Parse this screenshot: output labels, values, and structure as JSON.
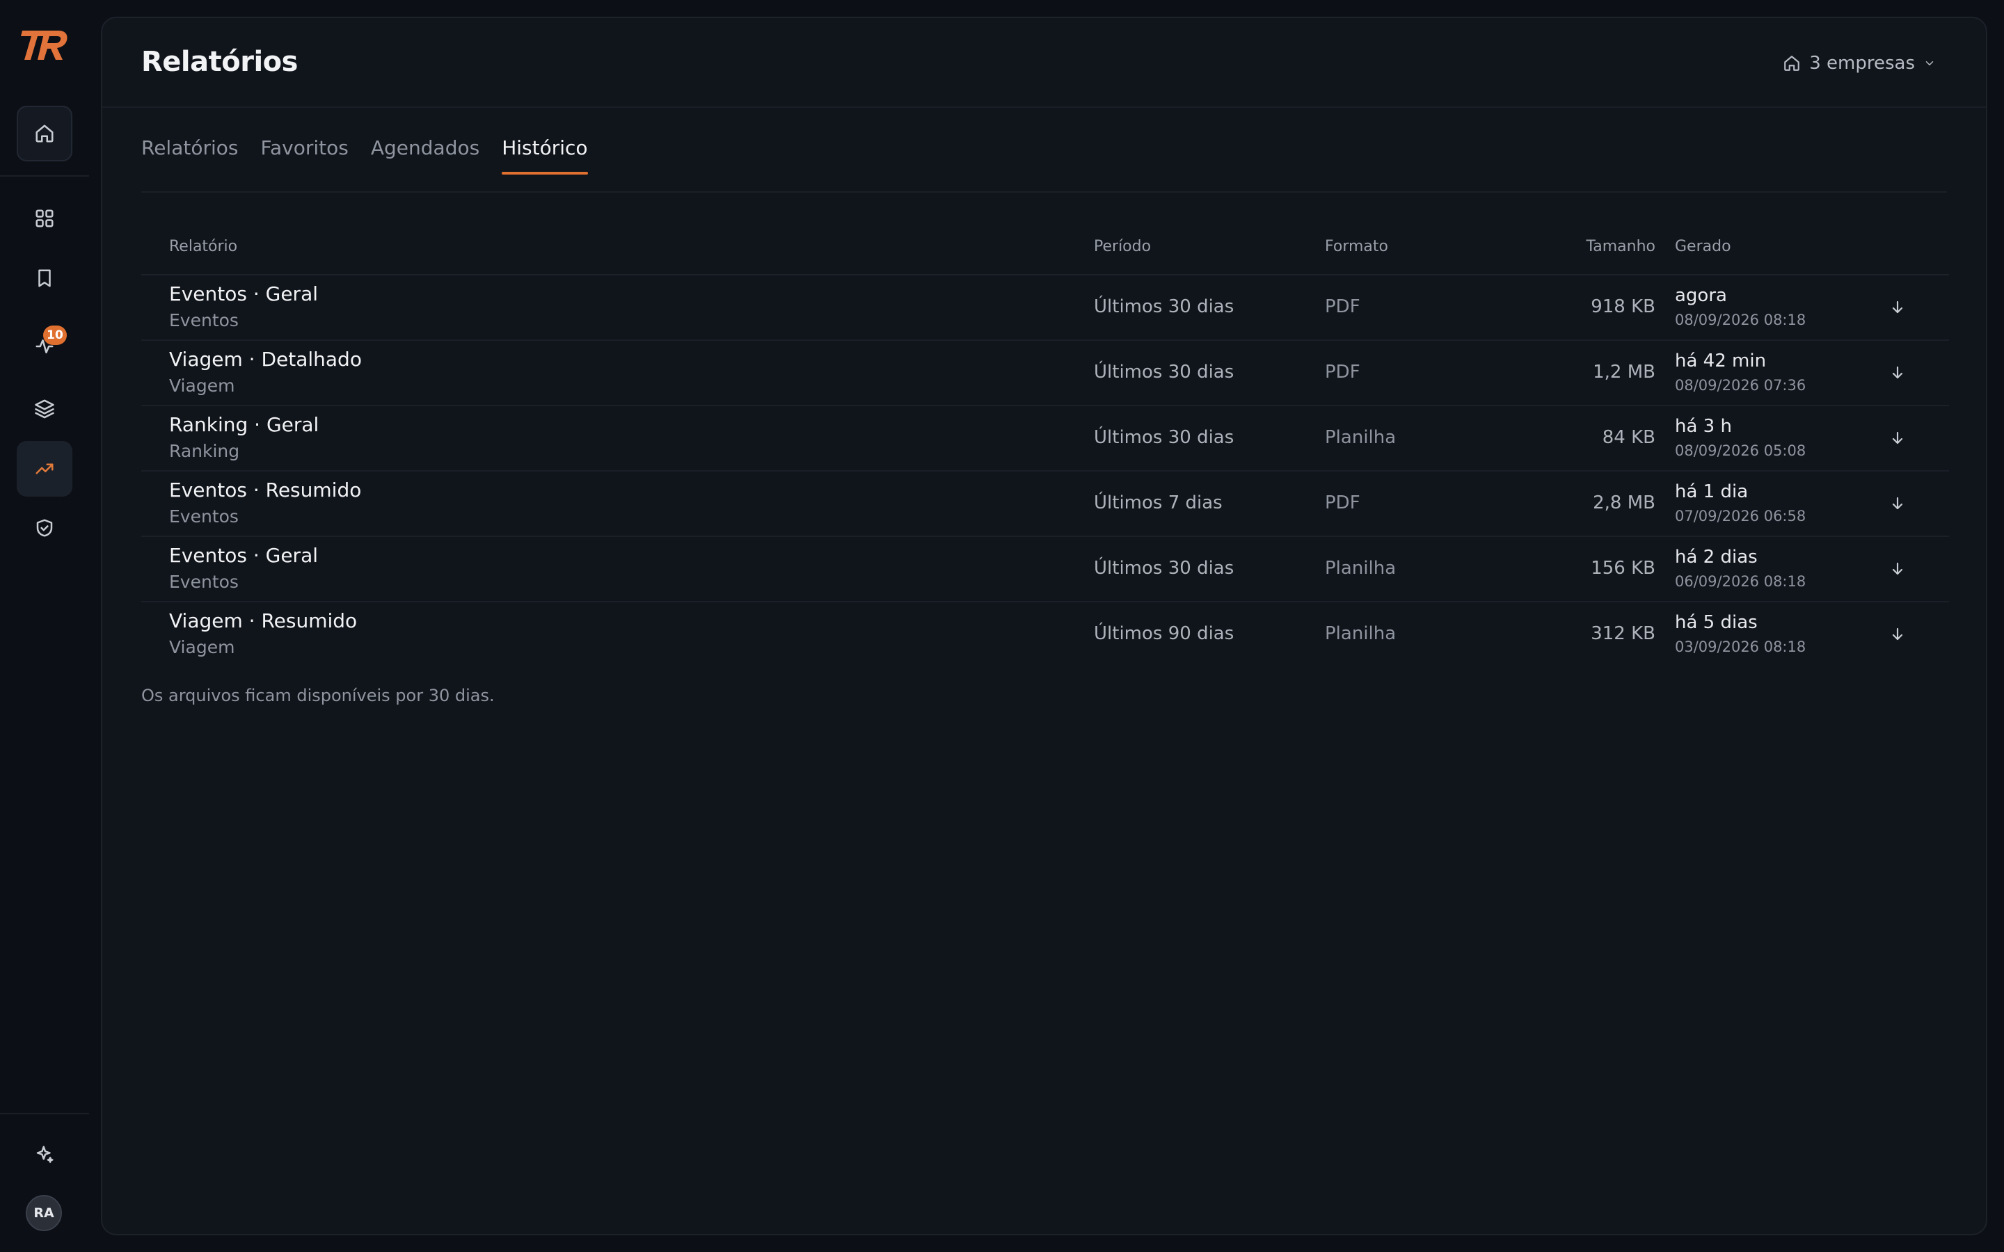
{
  "sidebar": {
    "logo_text": "TR",
    "items": [
      {
        "name": "home",
        "icon": "home-icon"
      },
      {
        "name": "dashboards",
        "icon": "grid-icon"
      },
      {
        "name": "favorites",
        "icon": "bookmark-icon"
      },
      {
        "name": "activity",
        "icon": "activity-icon",
        "badge": "10"
      },
      {
        "name": "layers",
        "icon": "layers-icon"
      },
      {
        "name": "reports",
        "icon": "trending-up-icon",
        "active": true
      },
      {
        "name": "security",
        "icon": "shield-check-icon"
      }
    ],
    "assistant_icon": "sparkle-icon",
    "user_initials": "RA"
  },
  "header": {
    "title": "Relatórios",
    "company_selector": "3 empresas"
  },
  "tabs": [
    {
      "label": "Relatórios"
    },
    {
      "label": "Favoritos"
    },
    {
      "label": "Agendados"
    },
    {
      "label": "Histórico",
      "active": true
    }
  ],
  "table": {
    "columns": {
      "report": "Relatório",
      "period": "Período",
      "format": "Formato",
      "size": "Tamanho",
      "generated": "Gerado"
    },
    "rows": [
      {
        "name": "Eventos · Geral",
        "category": "Eventos",
        "period": "Últimos 30 dias",
        "format": "PDF",
        "size": "918 KB",
        "relative": "agora",
        "timestamp": "08/09/2026 08:18"
      },
      {
        "name": "Viagem · Detalhado",
        "category": "Viagem",
        "period": "Últimos 30 dias",
        "format": "PDF",
        "size": "1,2 MB",
        "relative": "há 42 min",
        "timestamp": "08/09/2026 07:36"
      },
      {
        "name": "Ranking · Geral",
        "category": "Ranking",
        "period": "Últimos 30 dias",
        "format": "Planilha",
        "size": "84 KB",
        "relative": "há 3 h",
        "timestamp": "08/09/2026 05:08"
      },
      {
        "name": "Eventos · Resumido",
        "category": "Eventos",
        "period": "Últimos 7 dias",
        "format": "PDF",
        "size": "2,8 MB",
        "relative": "há 1 dia",
        "timestamp": "07/09/2026 06:58"
      },
      {
        "name": "Eventos · Geral",
        "category": "Eventos",
        "period": "Últimos 30 dias",
        "format": "Planilha",
        "size": "156 KB",
        "relative": "há 2 dias",
        "timestamp": "06/09/2026 08:18"
      },
      {
        "name": "Viagem · Resumido",
        "category": "Viagem",
        "period": "Últimos 90 dias",
        "format": "Planilha",
        "size": "312 KB",
        "relative": "há 5 dias",
        "timestamp": "03/09/2026 08:18"
      }
    ]
  },
  "footnote": "Os arquivos ficam disponíveis por 30 dias.",
  "colors": {
    "accent": "#e0702f",
    "background": "#0c0f15",
    "panel": "#10141b"
  }
}
